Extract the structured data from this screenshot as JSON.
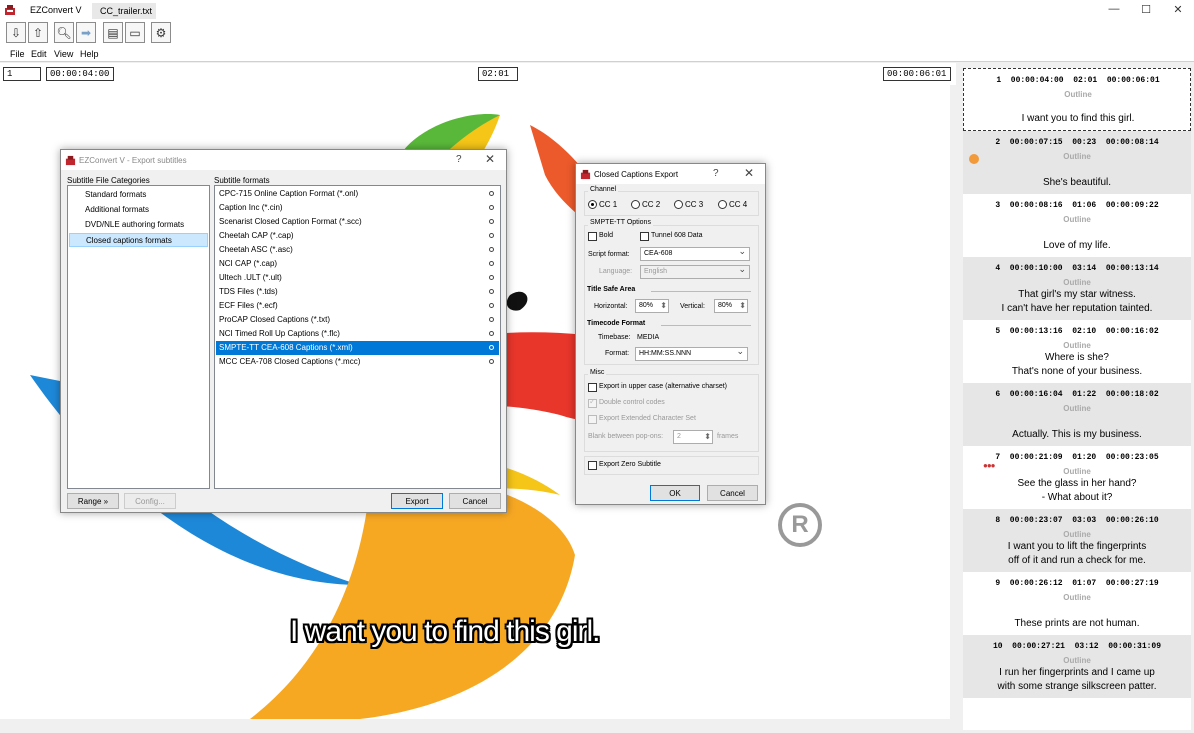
{
  "app": {
    "title": "EZConvert V",
    "doc_tab": "CC_trailer.txt"
  },
  "window_controls": {
    "minimize": "—",
    "maximize": "☐",
    "close": "✕"
  },
  "menu": [
    "File",
    "Edit",
    "View",
    "Help"
  ],
  "timecodes": {
    "index": "1",
    "start": "00:00:04:00",
    "duration": "02:01",
    "end": "00:00:06:01"
  },
  "video": {
    "subtitle": "I want you to find this girl.",
    "reg_mark": "R"
  },
  "subtitles": [
    {
      "num": "1",
      "start": "00:00:04:00",
      "dur": "02:01",
      "end": "00:00:06:01",
      "style": "Outline",
      "lines": [
        "I want you to find this girl."
      ]
    },
    {
      "num": "2",
      "start": "00:00:07:15",
      "dur": "00:23",
      "end": "00:00:08:14",
      "style": "Outline",
      "lines": [
        "She's beautiful."
      ]
    },
    {
      "num": "3",
      "start": "00:00:08:16",
      "dur": "01:06",
      "end": "00:00:09:22",
      "style": "Outline",
      "lines": [
        "Love of my life."
      ]
    },
    {
      "num": "4",
      "start": "00:00:10:00",
      "dur": "03:14",
      "end": "00:00:13:14",
      "style": "Outline",
      "lines": [
        "That girl's my star witness.",
        "I can't have her reputation tainted."
      ]
    },
    {
      "num": "5",
      "start": "00:00:13:16",
      "dur": "02:10",
      "end": "00:00:16:02",
      "style": "Outline",
      "lines": [
        "Where is she?",
        "That's none of your business."
      ]
    },
    {
      "num": "6",
      "start": "00:00:16:04",
      "dur": "01:22",
      "end": "00:00:18:02",
      "style": "Outline",
      "lines": [
        "Actually. This is my business."
      ]
    },
    {
      "num": "7",
      "start": "00:00:21:09",
      "dur": "01:20",
      "end": "00:00:23:05",
      "style": "Outline",
      "lines": [
        "See the glass in her hand?",
        "- What about it?"
      ]
    },
    {
      "num": "8",
      "start": "00:00:23:07",
      "dur": "03:03",
      "end": "00:00:26:10",
      "style": "Outline",
      "lines": [
        "I want you to lift the fingerprints",
        "off of it and run a check for me."
      ]
    },
    {
      "num": "9",
      "start": "00:00:26:12",
      "dur": "01:07",
      "end": "00:00:27:19",
      "style": "Outline",
      "lines": [
        "These prints are not human."
      ]
    },
    {
      "num": "10",
      "start": "00:00:27:21",
      "dur": "03:12",
      "end": "00:00:31:09",
      "style": "Outline",
      "lines": [
        "I run her fingerprints and I came up",
        "with some strange silkscreen patter."
      ]
    }
  ],
  "export_dialog": {
    "title": "EZConvert V - Export subtitles",
    "help": "?",
    "close": "✕",
    "categories_label": "Subtitle File Categories",
    "formats_label": "Subtitle formats",
    "categories": [
      "Standard formats",
      "Additional formats",
      "DVD/NLE authoring formats",
      "Closed captions formats"
    ],
    "formats": [
      "CPC-715 Online Caption Format  (*.onl)",
      "Caption Inc  (*.cin)",
      "Scenarist Closed Caption Format  (*.scc)",
      "Cheetah CAP  (*.cap)",
      "Cheetah ASC  (*.asc)",
      "NCI CAP  (*.cap)",
      "Ultech .ULT  (*.ult)",
      "TDS Files  (*.tds)",
      "ECF Files  (*.ecf)",
      "ProCAP Closed Captions  (*.txt)",
      "NCI Timed Roll Up Captions  (*.flc)",
      "SMPTE-TT CEA-608 Captions  (*.xml)",
      "MCC CEA-708 Closed Captions  (*.mcc)"
    ],
    "range_btn": "Range »",
    "config_btn": "Config...",
    "export_btn": "Export",
    "cancel_btn": "Cancel"
  },
  "cc_dialog": {
    "title": "Closed Captions Export",
    "help": "?",
    "close": "✕",
    "channel_label": "Channel",
    "channels": [
      "CC 1",
      "CC 2",
      "CC 3",
      "CC 4"
    ],
    "smpte_label": "SMPTE-TT Options",
    "bold_label": "Bold",
    "tunnel_label": "Tunnel 608 Data",
    "script_format_label": "Script format:",
    "script_format_value": "CEA-608",
    "language_label": "Language:",
    "language_value": "English",
    "title_safe_label": "Title Safe Area",
    "horizontal_label": "Horizontal:",
    "horizontal_value": "80%",
    "vertical_label": "Vertical:",
    "vertical_value": "80%",
    "timecode_label": "Timecode Format",
    "timebase_label": "Timebase:",
    "timebase_value": "MEDIA",
    "format_label": "Format:",
    "format_value": "HH:MM:SS.NNN",
    "misc_label": "Misc",
    "upper_case_label": "Export in upper case (alternative charset)",
    "double_codes_label": "Double control codes",
    "extended_label": "Export Extended Character Set",
    "blank_label": "Blank between pop-ons:",
    "blank_value": "2",
    "frames_label": "frames",
    "zero_sub_label": "Export Zero Subtitle",
    "ok_btn": "OK",
    "cancel_btn": "Cancel"
  },
  "colors": {
    "selection": "#0078d7",
    "alt_row": "#e6e6e6",
    "clock": "#f29a3a"
  }
}
